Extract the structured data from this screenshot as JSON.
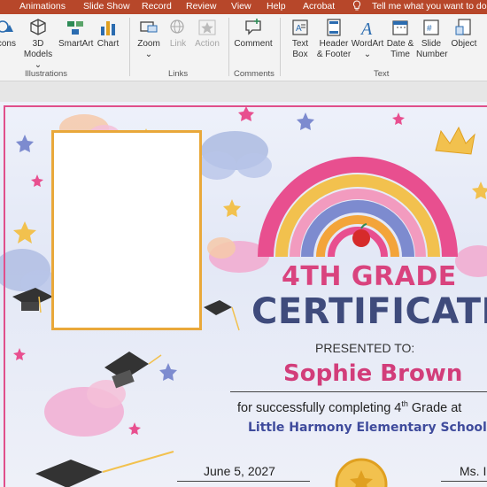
{
  "ribbon_tabs": [
    {
      "label": "Animations"
    },
    {
      "label": "Slide Show"
    },
    {
      "label": "Record"
    },
    {
      "label": "Review"
    },
    {
      "label": "View"
    },
    {
      "label": "Help"
    },
    {
      "label": "Acrobat"
    }
  ],
  "tell_me": "Tell me what you want to do",
  "ribbon": {
    "buttons": {
      "icons": "Icons",
      "models_3d_line1": "3D",
      "models_3d_line2": "Models",
      "smartart": "SmartArt",
      "chart": "Chart",
      "zoom": "Zoom",
      "link": "Link",
      "action": "Action",
      "comment": "Comment",
      "textbox_line1": "Text",
      "textbox_line2": "Box",
      "header_line1": "Header",
      "header_line2": "& Footer",
      "wordart": "WordArt",
      "datetime_line1": "Date &",
      "datetime_line2": "Time",
      "slidenum_line1": "Slide",
      "slidenum_line2": "Number",
      "object": "Object"
    },
    "groups": {
      "illustrations": "Illustrations",
      "links": "Links",
      "comments": "Comments",
      "text": "Text"
    }
  },
  "certificate": {
    "grade": "4TH GRADE",
    "title": "CERTIFICATE",
    "presented_to": "PRESENTED TO:",
    "recipient": "Sophie Brown",
    "reason_prefix": "for successfully completing 4",
    "reason_sup": "th",
    "reason_suffix": " Grade at",
    "school": "Little Harmony Elementary School",
    "date": "June 5, 2027",
    "signer": "Ms. I"
  },
  "colors": {
    "ribbon_tab_bar": "#b7472a",
    "accent_pink": "#d9437e",
    "title_navy": "#3f4b7c",
    "photo_border": "#e9a83a",
    "school_blue": "#3f4b9c"
  }
}
